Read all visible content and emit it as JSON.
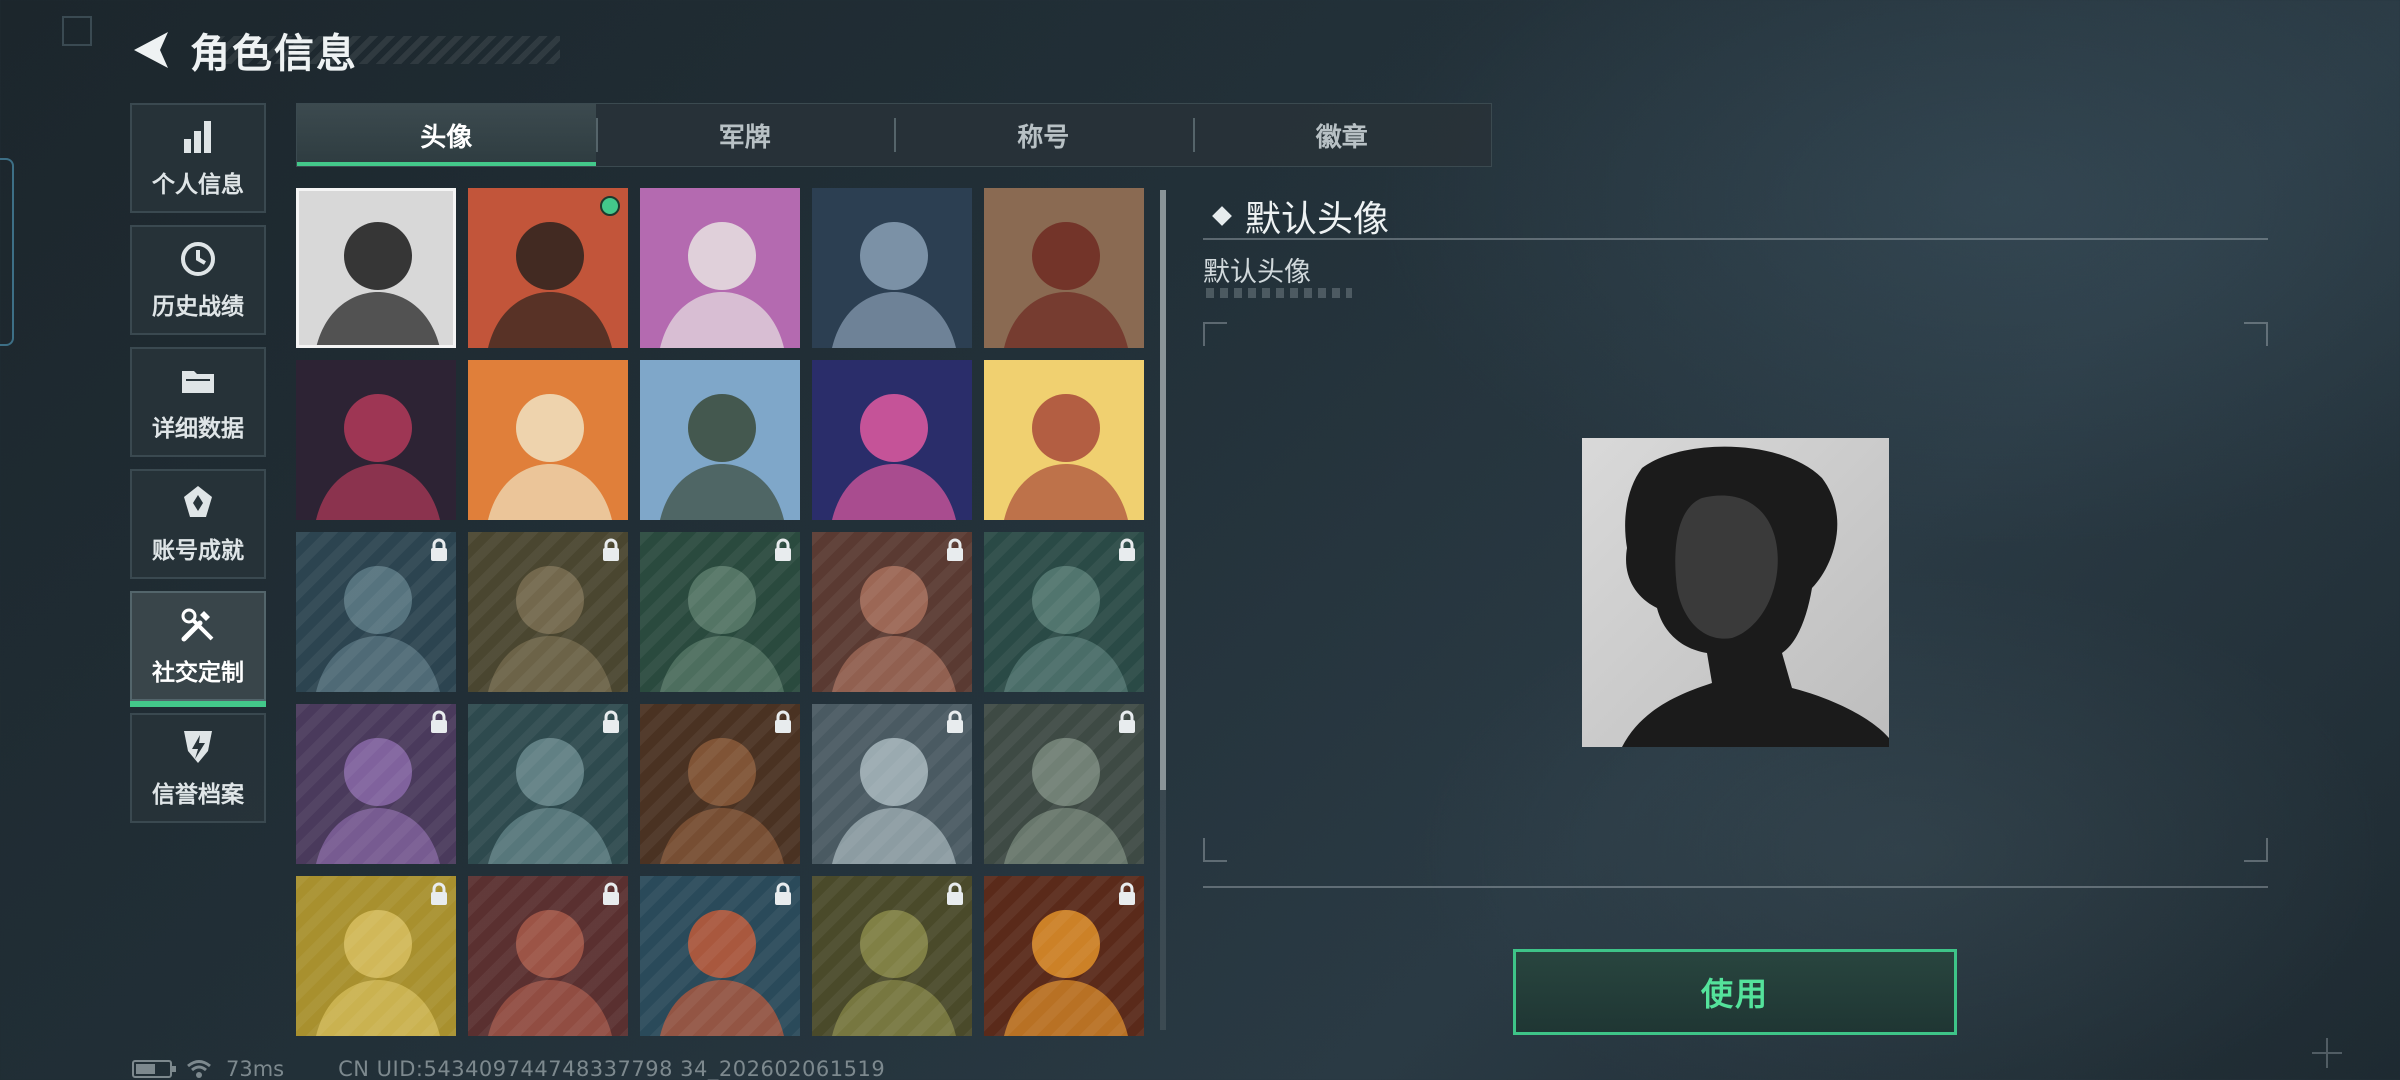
{
  "header": {
    "title": "角色信息"
  },
  "sidebar": {
    "items": [
      {
        "label": "个人信息",
        "icon": "bar-chart-icon"
      },
      {
        "label": "历史战绩",
        "icon": "history-clock-icon"
      },
      {
        "label": "详细数据",
        "icon": "folder-icon"
      },
      {
        "label": "账号成就",
        "icon": "achievement-badge-icon"
      },
      {
        "label": "社交定制",
        "icon": "tools-icon",
        "active": true
      },
      {
        "label": "信誉档案",
        "icon": "lightning-shield-icon"
      }
    ]
  },
  "tabs": [
    {
      "label": "头像",
      "active": true
    },
    {
      "label": "军牌"
    },
    {
      "label": "称号"
    },
    {
      "label": "徽章"
    }
  ],
  "avatars": [
    {
      "name": "avatar-default-portrait",
      "selected": true,
      "locked": false
    },
    {
      "name": "avatar-cap-headset-soldier",
      "locked": false,
      "equipped": true
    },
    {
      "name": "avatar-white-hair-girl",
      "locked": false
    },
    {
      "name": "avatar-scope-rifle",
      "locked": false
    },
    {
      "name": "avatar-scales-emblem",
      "locked": false
    },
    {
      "name": "avatar-turban-character",
      "locked": false
    },
    {
      "name": "avatar-monkey-reading",
      "locked": false
    },
    {
      "name": "avatar-pyramid-explorer",
      "locked": false
    },
    {
      "name": "avatar-2026-fireworks",
      "locked": false
    },
    {
      "name": "avatar-food-bowl",
      "locked": false
    },
    {
      "name": "avatar-helmet-goggles-woman",
      "locked": true
    },
    {
      "name": "avatar-bearded-headset",
      "locked": true
    },
    {
      "name": "avatar-soldier-headphones",
      "locked": true
    },
    {
      "name": "avatar-goggles-helmet",
      "locked": true
    },
    {
      "name": "avatar-glasses-beard",
      "locked": true
    },
    {
      "name": "avatar-purple-woman",
      "locked": true
    },
    {
      "name": "avatar-masked-helmet",
      "locked": true
    },
    {
      "name": "avatar-face-cover",
      "locked": true
    },
    {
      "name": "avatar-star-gear-emblem",
      "locked": true
    },
    {
      "name": "avatar-helicopter-field",
      "locked": true
    },
    {
      "name": "avatar-ramen-cartoon",
      "locked": true
    },
    {
      "name": "avatar-red-hair-woman",
      "locked": true
    },
    {
      "name": "avatar-eri-globe",
      "locked": true
    },
    {
      "name": "avatar-glasses-soldier",
      "locked": true
    },
    {
      "name": "avatar-explosion-hand",
      "locked": true
    }
  ],
  "detail": {
    "title": "默认头像",
    "subtitle": "默认头像"
  },
  "use_button": {
    "label": "使用"
  },
  "status": {
    "ping": "73ms",
    "uid": "CN UID:543409744748337798 34_202602061519"
  },
  "colors": {
    "accent": "#43c88a",
    "button_text": "#54e29b",
    "panel": "#283439"
  }
}
